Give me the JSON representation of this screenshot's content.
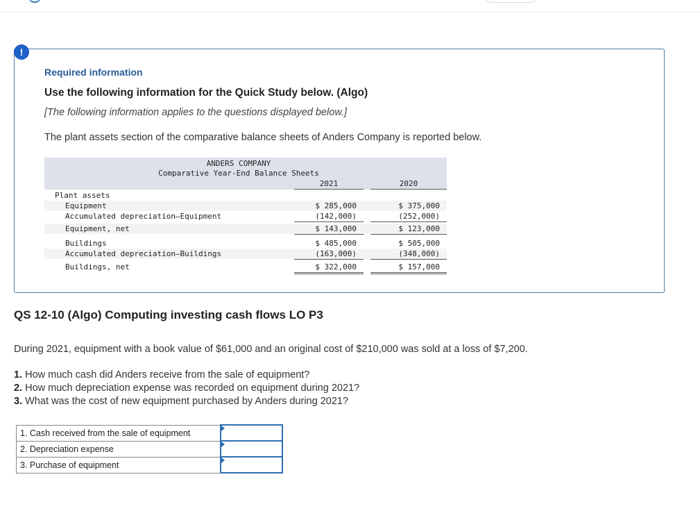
{
  "alert": {
    "icon": "exclamation-icon",
    "symbol": "!"
  },
  "info": {
    "required_title": "Required information",
    "use_title": "Use the following information for the Quick Study below. (Algo)",
    "applies_text": "[The following information applies to the questions displayed below.]",
    "plant_desc": "The plant assets section of the comparative balance sheets of Anders Company is reported below."
  },
  "balance_sheet": {
    "company": "ANDERS COMPANY",
    "subtitle": "Comparative Year-End Balance Sheets",
    "years": [
      "2021",
      "2020"
    ],
    "section_label": "Plant assets",
    "rows": [
      {
        "label": "Equipment",
        "v2021": "$ 285,000",
        "v2020": "$ 375,000"
      },
      {
        "label": "Accumulated depreciation—Equipment",
        "v2021": "(142,000)",
        "v2020": "(252,000)"
      },
      {
        "label": "Equipment, net",
        "v2021": "$ 143,000",
        "v2020": "$ 123,000"
      },
      {
        "label": "Buildings",
        "v2021": "$ 485,000",
        "v2020": "$ 505,000"
      },
      {
        "label": "Accumulated depreciation—Buildings",
        "v2021": "(163,000)",
        "v2020": "(348,000)"
      },
      {
        "label": "Buildings, net",
        "v2021": "$ 322,000",
        "v2020": "$ 157,000"
      }
    ]
  },
  "question": {
    "title": "QS 12-10 (Algo) Computing investing cash flows LO P3",
    "during_text": "During 2021, equipment with a book value of $61,000 and an original cost of $210,000 was sold at a loss of $7,200.",
    "items": [
      {
        "num": "1.",
        "text": "How much cash did Anders receive from the sale of equipment?"
      },
      {
        "num": "2.",
        "text": "How much depreciation expense was recorded on equipment during 2021?"
      },
      {
        "num": "3.",
        "text": "What was the cost of new equipment purchased by Anders during 2021?"
      }
    ]
  },
  "answers": [
    {
      "label": "1. Cash received from the sale of equipment",
      "value": ""
    },
    {
      "label": "2. Depreciation expense",
      "value": ""
    },
    {
      "label": "3. Purchase of equipment",
      "value": ""
    }
  ]
}
